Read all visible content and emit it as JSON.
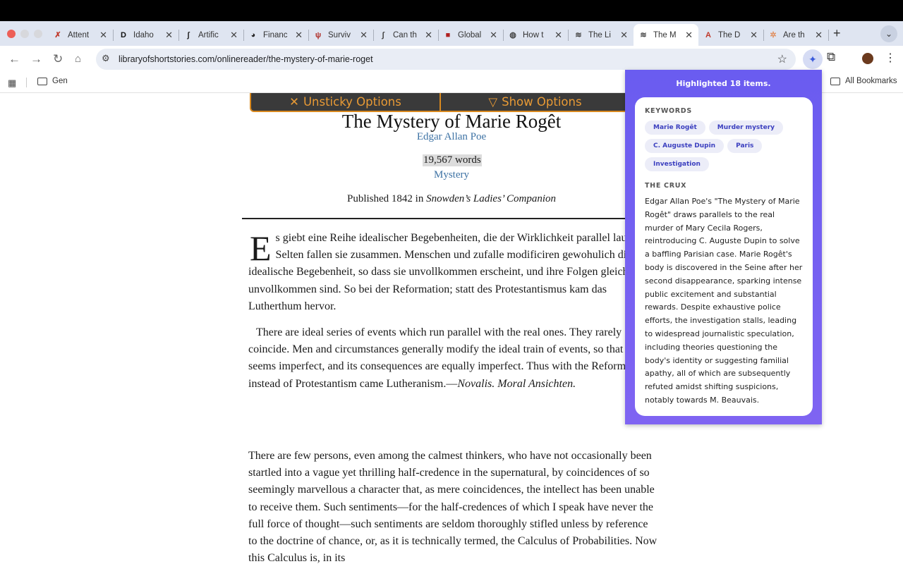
{
  "tabs": [
    {
      "title": "Attent",
      "icon": "x-logo-icon",
      "color": "#c0392b"
    },
    {
      "title": "Idaho",
      "icon": "d-logo-icon",
      "color": "#111111"
    },
    {
      "title": "Artific",
      "icon": "swirl-logo-icon",
      "color": "#222222"
    },
    {
      "title": "Financ",
      "icon": "globe-logo-icon",
      "color": "#222222"
    },
    {
      "title": "Surviv",
      "icon": "trident-logo-icon",
      "color": "#b0302a"
    },
    {
      "title": "Can th",
      "icon": "script-logo-icon",
      "color": "#444444"
    },
    {
      "title": "Global",
      "icon": "red-square-logo-icon",
      "color": "#b02020"
    },
    {
      "title": "How t",
      "icon": "world-icon",
      "color": "#444444"
    },
    {
      "title": "The Li",
      "icon": "book-logo-icon",
      "color": "#444444"
    },
    {
      "title": "The M",
      "icon": "book-logo-icon",
      "color": "#444444",
      "active": true
    },
    {
      "title": "The D",
      "icon": "a-logo-icon",
      "color": "#c0392b"
    },
    {
      "title": "Are th",
      "icon": "sparkle-icon",
      "color": "#e09060"
    }
  ],
  "address": {
    "url": "libraryofshortstories.com/onlinereader/the-mystery-of-marie-roget"
  },
  "bookmarks": {
    "folder1": "Gen",
    "all": "All Bookmarks"
  },
  "options": {
    "unsticky": "Unsticky Options",
    "show": "Show Options"
  },
  "story": {
    "title": "The Mystery of Marie Rogêt",
    "author": "Edgar Allan Poe",
    "words": "19,567 words",
    "genre": "Mystery",
    "published_prefix": "Published 1842 in ",
    "publication": "Snowden’s Ladies’ Companion",
    "dropcap": "E",
    "p1": "s giebt eine Reihe idealischer Begebenheiten, die der Wirklichkeit parallel lauft. Selten fallen sie zusammen. Menschen und zufalle modificiren gewohulich die idealische Begebenheit, so dass sie unvollkommen erscheint, und ihre Folgen gleichfalls unvollkommen sind. So bei der Reformation; statt des Protestantismus kam das Lutherthum hervor.",
    "p2": "There are ideal series of events which run parallel with the real ones. They rarely coincide. Men and circumstances generally modify the ideal train of events, so that it seems imperfect, and its consequences are equally imperfect. Thus with the Reformation; instead of Protestantism came Lutheranism.—",
    "p2_cite": "Novalis. Moral Ansichten.",
    "p3": "There are few persons, even among the calmest thinkers, who have not occasionally been startled into a vague yet thrilling half-credence in the supernatural, by coincidences of so seemingly marvellous a character that, as mere coincidences, the intellect has been unable to receive them. Such sentiments—for the half-credences of which I speak have never the full force of thought—such sentiments are seldom thoroughly stifled unless by reference to the doctrine of chance, or, as it is technically termed, the Calculus of Probabilities. Now this Calculus is, in its"
  },
  "panel": {
    "header": "Highlighted 18 items.",
    "keywords_label": "KEYWORDS",
    "keywords": [
      "Marie Rogêt",
      "Murder mystery",
      "C. Auguste Dupin",
      "Paris",
      "Investigation"
    ],
    "crux_label": "THE CRUX",
    "crux": "Edgar Allan Poe's \"The Mystery of Marie Rogêt\" draws parallels to the real murder of Mary Cecila Rogers, reintroducing C. Auguste Dupin to solve a baffling Parisian case. Marie Rogêt's body is discovered in the Seine after her second disappearance, sparking intense public excitement and substantial rewards. Despite exhaustive police efforts, the investigation stalls, leading to widespread journalistic speculation, including theories questioning the body's identity or suggesting familial apathy, all of which are subsequently refuted amidst shifting suspicions, notably towards M. Beauvais."
  },
  "colors": {
    "accent": "#e89a35",
    "link": "#3d72a4",
    "panel": "#6a5cf0"
  }
}
